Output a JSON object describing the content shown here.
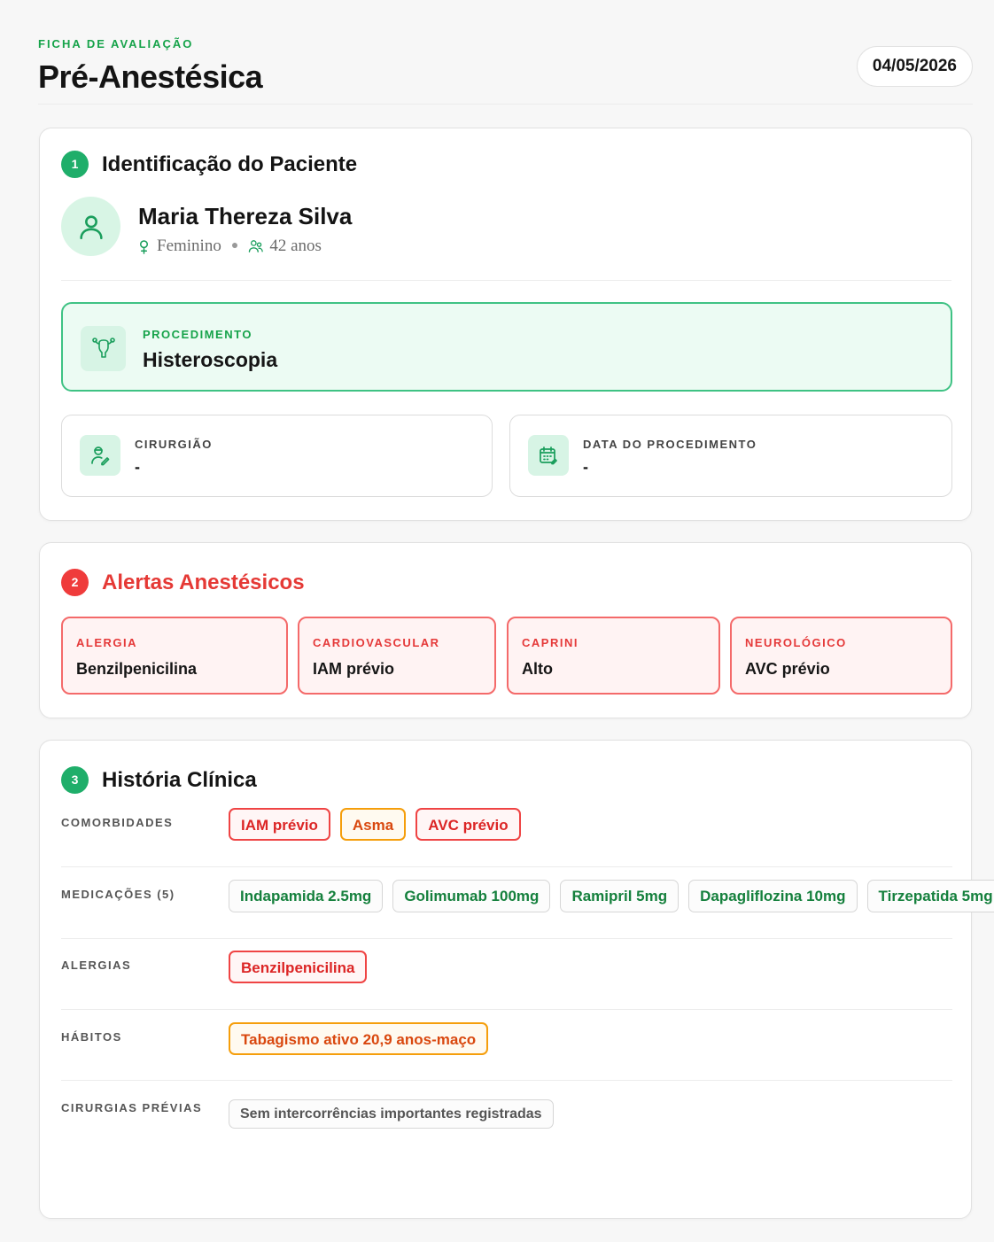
{
  "header": {
    "eyebrow": "FICHA DE AVALIAÇÃO",
    "title": "Pré-Anestésica",
    "date": "04/05/2026"
  },
  "identificacao": {
    "number": "1",
    "title": "Identificação do Paciente",
    "patient_name": "Maria Thereza Silva",
    "sex": "Feminino",
    "age": "42 anos",
    "procedure_label": "PROCEDIMENTO",
    "procedure_value": "Histeroscopia",
    "surgeon_label": "CIRURGIÃO",
    "surgeon_value": "-",
    "proc_date_label": "DATA DO PROCEDIMENTO",
    "proc_date_value": "-",
    "icons": [
      "user-icon",
      "female-icon",
      "people-icon",
      "uterus-icon",
      "doctor-icon",
      "calendar-icon"
    ]
  },
  "alertas": {
    "number": "2",
    "title": "Alertas Anestésicos",
    "items": [
      {
        "label": "ALERGIA",
        "value": "Benzilpenicilina"
      },
      {
        "label": "CARDIOVASCULAR",
        "value": "IAM prévio"
      },
      {
        "label": "CAPRINI",
        "value": "Alto"
      },
      {
        "label": "NEUROLÓGICO",
        "value": "AVC prévio"
      }
    ]
  },
  "historia": {
    "number": "3",
    "title": "História Clínica",
    "comorbidades_label": "COMORBIDADES",
    "comorbidades": [
      "IAM prévio",
      "Asma",
      "AVC prévio"
    ],
    "medicacoes_label": "MEDICAÇÕES (5)",
    "medicacoes": [
      "Indapamida 2.5mg",
      "Golimumab 100mg",
      "Ramipril 5mg",
      "Dapagliflozina 10mg",
      "Tirzepatida 5mg"
    ],
    "alergias_label": "ALERGIAS",
    "alergias": [
      "Benzilpenicilina"
    ],
    "habitos_label": "HÁBITOS",
    "habitos": [
      "Tabagismo ativo 20,9 anos-maço"
    ],
    "cirurgias_label": "CIRURGIAS PRÉVIAS",
    "cirurgias": [
      "Sem intercorrências importantes registradas"
    ]
  },
  "colors": {
    "accent_green": "#1fae6a",
    "alert_red": "#ef3b3b",
    "warning_orange": "#f59e0b"
  }
}
